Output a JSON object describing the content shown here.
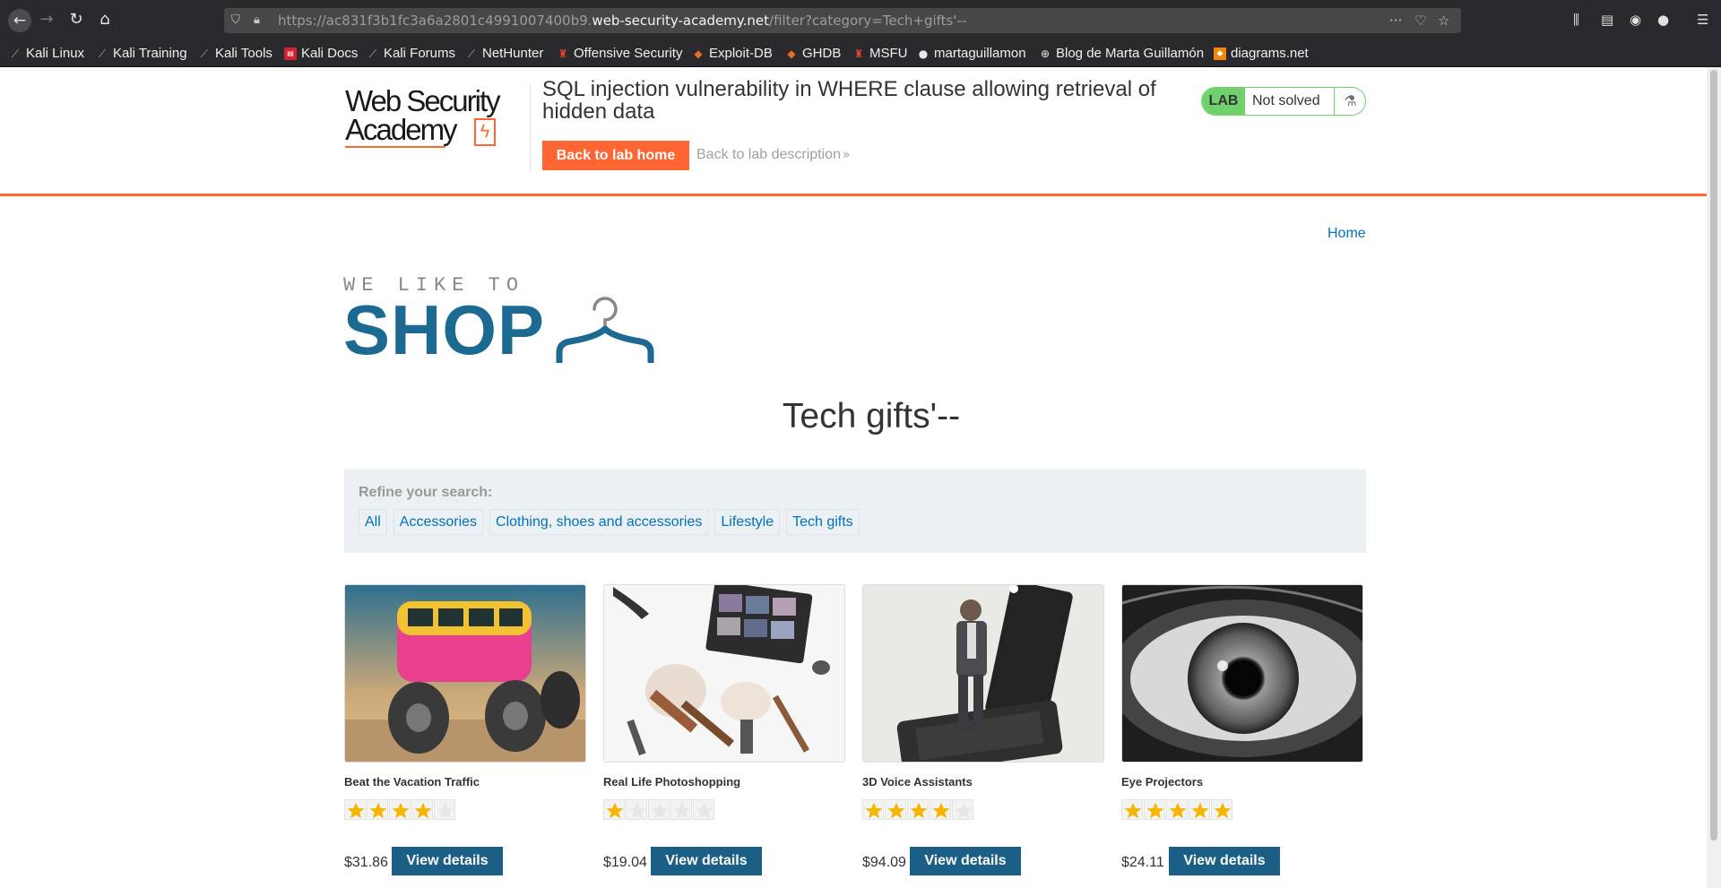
{
  "browser": {
    "url_prefix": "https://ac831f3b1fc3a6a2801c4991007400b9.",
    "url_host": "web-security-academy.net",
    "url_path": "/filter?category=Tech+gifts'--",
    "bookmarks": [
      {
        "label": "Kali Linux",
        "icon": "kali-dragon-icon"
      },
      {
        "label": "Kali Training",
        "icon": "kali-dragon-icon"
      },
      {
        "label": "Kali Tools",
        "icon": "kali-dragon-icon"
      },
      {
        "label": "Kali Docs",
        "icon": "kali-docs-icon"
      },
      {
        "label": "Kali Forums",
        "icon": "kali-dragon-icon"
      },
      {
        "label": "NetHunter",
        "icon": "kali-dragon-icon"
      },
      {
        "label": "Offensive Security",
        "icon": "offsec-icon"
      },
      {
        "label": "Exploit-DB",
        "icon": "exploit-db-icon"
      },
      {
        "label": "GHDB",
        "icon": "exploit-db-icon"
      },
      {
        "label": "MSFU",
        "icon": "offsec-icon"
      },
      {
        "label": "martaguillamon",
        "icon": "github-icon"
      },
      {
        "label": "Blog de Marta Guillamón",
        "icon": "globe-icon"
      },
      {
        "label": "diagrams.net",
        "icon": "diagrams-icon"
      }
    ]
  },
  "lab": {
    "logo_line1": "Web Security",
    "logo_line2": "Academy",
    "title": "SQL injection vulnerability in WHERE clause allowing retrieval of hidden data",
    "back_home_label": "Back to lab home",
    "back_desc_label": "Back to lab description",
    "status_badge": "LAB",
    "status_text": "Not solved"
  },
  "nav": {
    "home_label": "Home"
  },
  "shop": {
    "logo_small": "WE LIKE TO",
    "logo_big": "SHOP",
    "category_title": "Tech gifts'--",
    "refine_label": "Refine your search:",
    "filters": [
      "All",
      "Accessories",
      "Clothing, shoes and accessories",
      "Lifestyle",
      "Tech gifts"
    ]
  },
  "products": [
    {
      "name": "Beat the Vacation Traffic",
      "rating": 4,
      "price": "$31.86",
      "button": "View details"
    },
    {
      "name": "Real Life Photoshopping",
      "rating": 1,
      "price": "$19.04",
      "button": "View details"
    },
    {
      "name": "3D Voice Assistants",
      "rating": 4,
      "price": "$94.09",
      "button": "View details"
    },
    {
      "name": "Eye Projectors",
      "rating": 5,
      "price": "$24.11",
      "button": "View details"
    }
  ],
  "colors": {
    "accent_orange": "#ff6633",
    "shop_blue": "#1c6a92",
    "button_blue": "#1c5f86",
    "link_blue": "#0071bc",
    "lab_green": "#70d16d",
    "star_gold": "#f7b500"
  }
}
